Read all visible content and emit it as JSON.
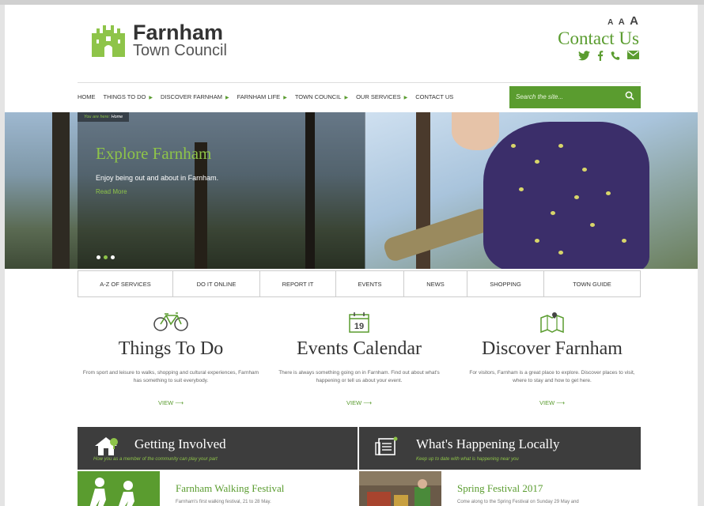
{
  "header": {
    "logo_line1": "Farnham",
    "logo_line2": "Town Council",
    "font_sizes": [
      "A",
      "A",
      "A"
    ],
    "contact_heading": "Contact Us",
    "social_icons": [
      "twitter-icon",
      "facebook-icon",
      "phone-icon",
      "email-icon"
    ]
  },
  "nav": {
    "items": [
      {
        "label": "HOME",
        "has_arrow": false
      },
      {
        "label": "THINGS TO DO",
        "has_arrow": true
      },
      {
        "label": "DISCOVER FARNHAM",
        "has_arrow": true
      },
      {
        "label": "FARNHAM LIFE",
        "has_arrow": true
      },
      {
        "label": "TOWN COUNCIL",
        "has_arrow": true
      },
      {
        "label": "OUR SERVICES",
        "has_arrow": true
      },
      {
        "label": "CONTACT US",
        "has_arrow": false
      }
    ],
    "search_placeholder": "Search the site..."
  },
  "hero": {
    "breadcrumb_prefix": "You are here:",
    "breadcrumb_current": "Home",
    "title": "Explore Farnham",
    "subtitle": "Enjoy being out and about in Farnham.",
    "more_link": "Read More",
    "slide_count": 3,
    "active_slide": 2
  },
  "services": [
    "A-Z OF SERVICES",
    "DO IT ONLINE",
    "REPORT IT",
    "EVENTS",
    "NEWS",
    "SHOPPING",
    "TOWN GUIDE"
  ],
  "features": [
    {
      "icon": "bicycle-icon",
      "title": "Things To Do",
      "text": "From sport and leisure to walks, shopping and cultural experiences, Farnham has something to suit everybody.",
      "link": "VIEW ⟶"
    },
    {
      "icon": "calendar-icon",
      "title": "Events Calendar",
      "text": "There is always something going on in Farnham. Find out about what's happening or tell us about your event.",
      "link": "VIEW ⟶",
      "calendar_day": "19"
    },
    {
      "icon": "map-icon",
      "title": "Discover Farnham",
      "text": "For visitors, Farnham is a great place to explore. Discover places to visit, where to stay and how to get here.",
      "link": "VIEW ⟶"
    }
  ],
  "panels": [
    {
      "icon": "house-icon",
      "title": "Getting Involved",
      "subtitle": "How you as a member of the community can play your part"
    },
    {
      "icon": "newspaper-icon",
      "title": "What's Happening Locally",
      "subtitle": "Keep up to date with what is happening near you"
    }
  ],
  "news": [
    {
      "title": "Farnham Walking Festival",
      "text": "Farnham's first walking festival, 21 to 28 May."
    },
    {
      "title": "Spring Festival 2017",
      "text": "Come along to the Spring Festival on Sunday 29 May and"
    }
  ],
  "colors": {
    "brand_green": "#5a9c2f",
    "hero_green": "#8ec449",
    "panel_dark": "#3d3d3d"
  }
}
